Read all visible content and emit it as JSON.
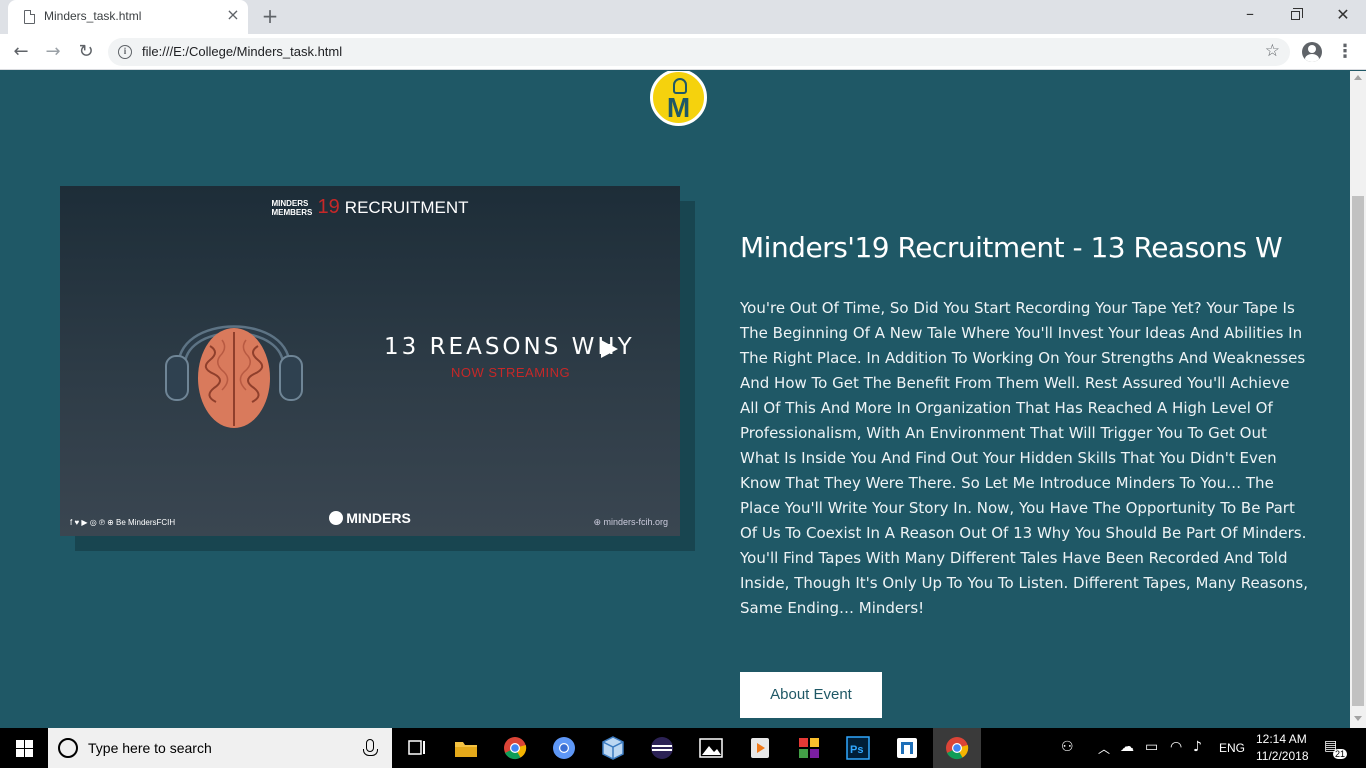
{
  "browser": {
    "tab_title": "Minders_task.html",
    "tab_close": "×",
    "new_tab": "+",
    "url": "file:///E:/College/Minders_task.html",
    "info_icon": "i",
    "star_icon": "☆",
    "back": "←",
    "forward": "→",
    "reload": "↻",
    "menu": "⋮",
    "window_min": "–",
    "window_close": "✕"
  },
  "poster": {
    "mm_line1": "MINDERS",
    "mm_line2": "MEMBERS",
    "year": "19",
    "recruitment": "RECRUITMENT",
    "headline": "13 REASONS WHY",
    "subline": "NOW STREAMING",
    "social": "f  ♥  ▶  ◎  ℗  ⊕  Be MindersFCIH",
    "brand": "MINDERS",
    "site": "⊕  minders-fcih.org"
  },
  "event": {
    "title": "Minders'19 Recruitment - 13 Reasons W",
    "description": "You're Out Of Time, So Did You Start Recording Your Tape Yet? Your Tape Is The Beginning Of A New Tale Where You'll Invest Your Ideas And Abilities In The Right Place. In Addition To Working On Your Strengths And Weaknesses And How To Get The Benefit From Them Well. Rest Assured You'll Achieve All Of This And More In Organization That Has Reached A High Level Of Professionalism, With An Environment That Will Trigger You To Get Out What Is Inside You And Find Out Your Hidden Skills That You Didn't Even Know That They Were There. So Let Me Introduce Minders To You… The Place You'll Write Your Story In. Now, You Have The Opportunity To Be Part Of Us To Coexist In A Reason Out Of 13 Why You Should Be Part Of Minders. You'll Find Tapes With Many Different Tales Have Been Recorded And Told Inside, Though It's Only Up To You To Listen. Different Tapes, Many Reasons, Same Ending… Minders!",
    "button_label": "About Event"
  },
  "logo": {
    "letter": "M"
  },
  "taskbar": {
    "search_placeholder": "Type here to search",
    "language": "ENG",
    "time": "12:14 AM",
    "date": "11/2/2018",
    "notification_count": "21"
  },
  "colors": {
    "page_bg": "#1f5866",
    "logo_yellow": "#f5d20d",
    "poster_red": "#c62828"
  }
}
